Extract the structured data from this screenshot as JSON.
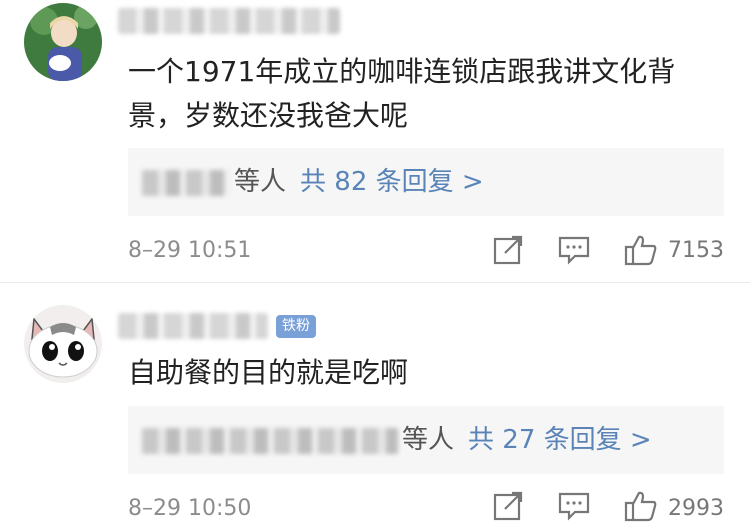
{
  "comments": [
    {
      "text": "一个1971年成立的咖啡连锁店跟我讲文化背景，岁数还没我爸大呢",
      "reply": {
        "who": "等人",
        "count": "共 82 条回复 >"
      },
      "timestamp": "8–29 10:51",
      "likes": "7153"
    },
    {
      "badge": "铁粉",
      "text": "自助餐的目的就是吃啊",
      "reply": {
        "who": "等人",
        "count": "共 27 条回复 >"
      },
      "timestamp": "8–29 10:50",
      "likes": "2993"
    }
  ],
  "icons": [
    "share-icon",
    "comment-icon",
    "thumbs-up-icon"
  ],
  "colors": {
    "link_blue": "#5a84b8",
    "badge_blue": "#7aa0d8",
    "reply_bg": "#f6f6f6",
    "meta_gray": "#8c8c8c"
  }
}
